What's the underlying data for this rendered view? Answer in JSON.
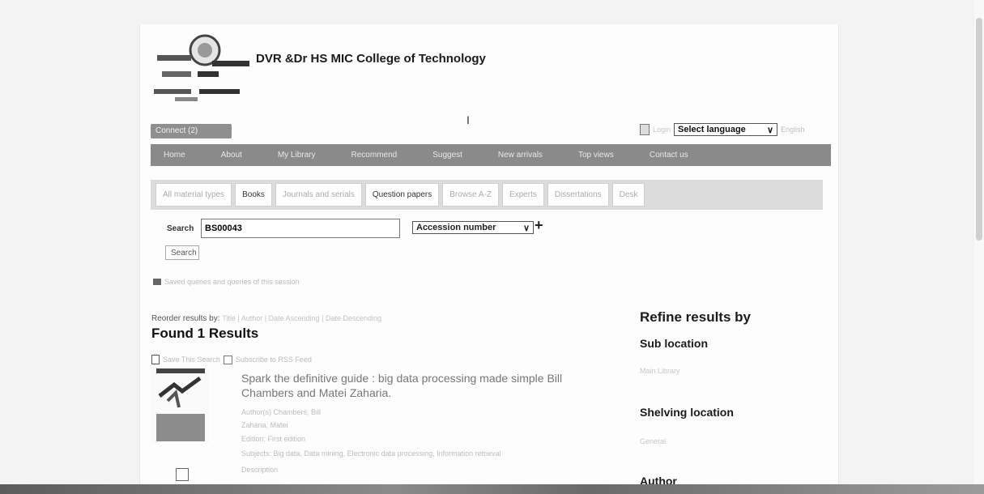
{
  "header": {
    "college_name": "DVR &Dr HS MIC College of Technology",
    "stray_mark": "I",
    "connect_label": "Connect (2)",
    "login_text": "Login",
    "language_select": "Select language",
    "lang_tail": "English"
  },
  "main_nav": [
    "Home",
    "About",
    "My Library",
    "Recommend",
    "Suggest",
    "New arrivals",
    "Top views",
    "Contact us"
  ],
  "tabs": [
    {
      "label": "All material types",
      "dark": false
    },
    {
      "label": "Books",
      "dark": true
    },
    {
      "label": "Journals and serials",
      "dark": false
    },
    {
      "label": "Question papers",
      "dark": false
    },
    {
      "label": "Browse A-Z",
      "dark": false
    },
    {
      "label": "Experts",
      "dark": false
    },
    {
      "label": "Dissertations",
      "dark": false
    },
    {
      "label": "Desk",
      "dark": false
    }
  ],
  "search": {
    "label": "Search",
    "value": "BS00043",
    "index_select": "Accession number",
    "add_symbol": "+",
    "button_label": "Search"
  },
  "saved_queries_text": "Saved queries and queries of this session",
  "results": {
    "relevance_label": "Reorder results by:",
    "relevance_options": "Title | Author | Date Ascending | Date Descending",
    "heading": "Found 1 Results",
    "actions_text": "Save This Search",
    "rss_text": "Subscribe to RSS Feed",
    "title": "Spark the definitive guide : big data processing made simple Bill Chambers and Matei Zaharia.",
    "lines": [
      "Author(s) Chambers, Bill",
      "Zaharia, Matei",
      "Edition: First edition",
      "Subjects: Big data, Data mining, Electronic data processing, Information retrieval",
      "Description"
    ]
  },
  "refine": {
    "title": "Refine results by",
    "sections": [
      {
        "heading": "Sub location",
        "items": [
          "Main Library"
        ]
      },
      {
        "heading": "Shelving location",
        "items": [
          "General"
        ]
      },
      {
        "heading": "Author",
        "items": []
      }
    ]
  }
}
